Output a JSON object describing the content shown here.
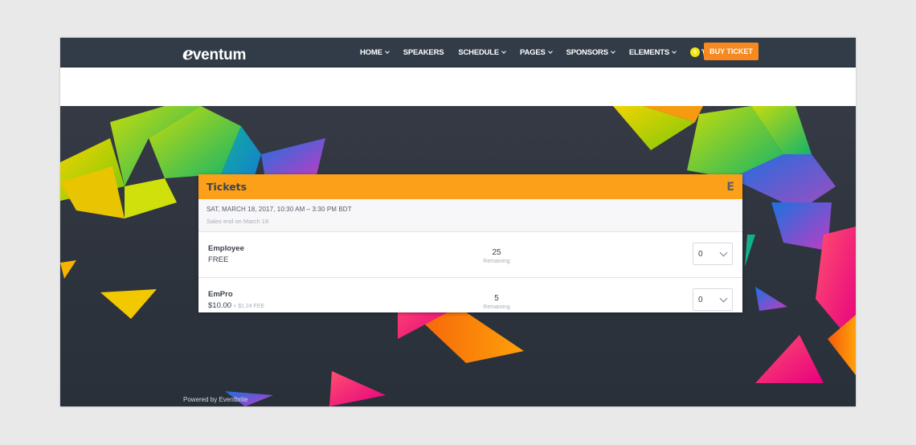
{
  "header": {
    "logo": "ventum",
    "logo_initial": "e",
    "nav": [
      {
        "label": "HOME",
        "dropdown": true
      },
      {
        "label": "SPEAKERS",
        "dropdown": false
      },
      {
        "label": "SCHEDULE",
        "dropdown": true
      },
      {
        "label": "PAGES",
        "dropdown": true
      },
      {
        "label": "SPONSORS",
        "dropdown": true
      },
      {
        "label": "ELEMENTS",
        "dropdown": true
      }
    ],
    "cart_count": "0",
    "buy_ticket_label": "BUY TICKET"
  },
  "widget": {
    "title": "Tickets",
    "brand_mark": "E",
    "date_line": "SAT, MARCH 18, 2017, 10:30 AM – 3:30 PM BDT",
    "sales_end": "Sales end on March 18",
    "tickets": [
      {
        "name": "Employee",
        "price": "FREE",
        "fee": "",
        "remaining_count": "25",
        "remaining_label": "Remaining",
        "selected_qty": "0"
      },
      {
        "name": "EmPro",
        "price": "$10.00",
        "fee": "+ $1.24 FEE",
        "remaining_count": "5",
        "remaining_label": "Remaining",
        "selected_qty": "0"
      }
    ]
  },
  "footer": {
    "powered_by": "Powered by Eventbrite"
  },
  "colors": {
    "nav_bg": "#323b48",
    "accent_orange": "#f6891f",
    "widget_header": "#fca019",
    "cart_badge": "#f3e60f"
  }
}
